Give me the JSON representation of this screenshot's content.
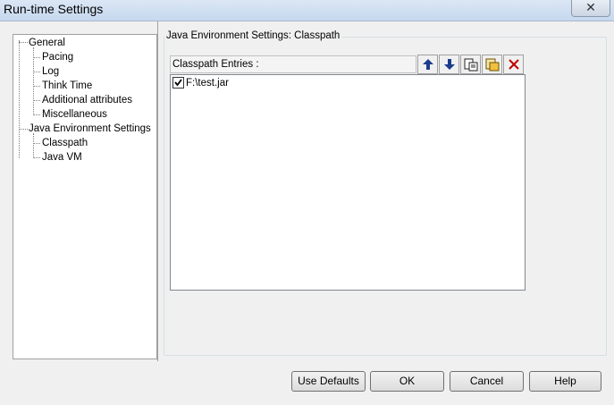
{
  "window": {
    "title": "Run-time Settings",
    "close_glyph": "✕"
  },
  "tree": {
    "items": [
      {
        "label": "General"
      },
      {
        "label": "Pacing"
      },
      {
        "label": "Log"
      },
      {
        "label": "Think Time"
      },
      {
        "label": "Additional attributes"
      },
      {
        "label": "Miscellaneous"
      },
      {
        "label": "Java Environment Settings"
      },
      {
        "label": "Classpath"
      },
      {
        "label": "Java VM"
      }
    ]
  },
  "group": {
    "label": "Java Environment Settings: Classpath"
  },
  "classpath": {
    "header": "Classpath Entries :",
    "toolbar": [
      "arrow-up-icon",
      "arrow-down-icon",
      "browse-folder-icon",
      "browse-file-icon",
      "delete-icon"
    ],
    "entries": [
      {
        "path": "F:\\test.jar",
        "checked": true
      }
    ]
  },
  "buttons": {
    "use_defaults": "Use Defaults",
    "ok": "OK",
    "cancel": "Cancel",
    "help": "Help"
  },
  "colors": {
    "arrow": "#1c3d8c",
    "delete": "#c00000"
  }
}
